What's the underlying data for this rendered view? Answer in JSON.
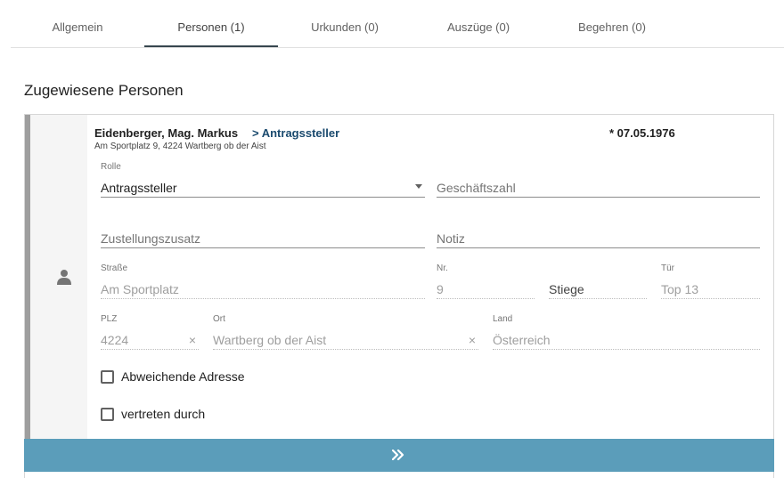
{
  "tabs": [
    {
      "label": "Allgemein"
    },
    {
      "label": "Personen (1)"
    },
    {
      "label": "Urkunden (0)"
    },
    {
      "label": "Auszüge (0)"
    },
    {
      "label": "Begehren (0)"
    }
  ],
  "section_title": "Zugewiesene Personen",
  "person": {
    "name": "Eidenberger, Mag. Markus",
    "role_link": "> Antragssteller",
    "address": "Am Sportplatz 9, 4224 Wartberg ob der Aist",
    "birth_date": "* 07.05.1976"
  },
  "form": {
    "rolle_label": "Rolle",
    "rolle_value": "Antragssteller",
    "geschaeftszahl_placeholder": "Geschäftszahl",
    "zustellungszusatz_placeholder": "Zustellungszusatz",
    "notiz_placeholder": "Notiz",
    "strasse_label": "Straße",
    "strasse_value": "Am Sportplatz",
    "nr_label": "Nr.",
    "nr_value": "9",
    "stiege_placeholder": "Stiege",
    "tuer_label": "Tür",
    "tuer_value": "Top 13",
    "plz_label": "PLZ",
    "plz_value": "4224",
    "ort_label": "Ort",
    "ort_value": "Wartberg ob der Aist",
    "land_label": "Land",
    "land_value": "Österreich",
    "clear_symbol": "×"
  },
  "checkboxes": {
    "abweichende_adresse": "Abweichende Adresse",
    "vertreten_durch": "vertreten durch"
  },
  "colors": {
    "accent": "#5b9dba",
    "active_tab_underline": "#37474f",
    "role_link": "#1a4a6e"
  },
  "icons": {
    "person": "person-icon",
    "expand": "double-chevron-right-icon"
  }
}
